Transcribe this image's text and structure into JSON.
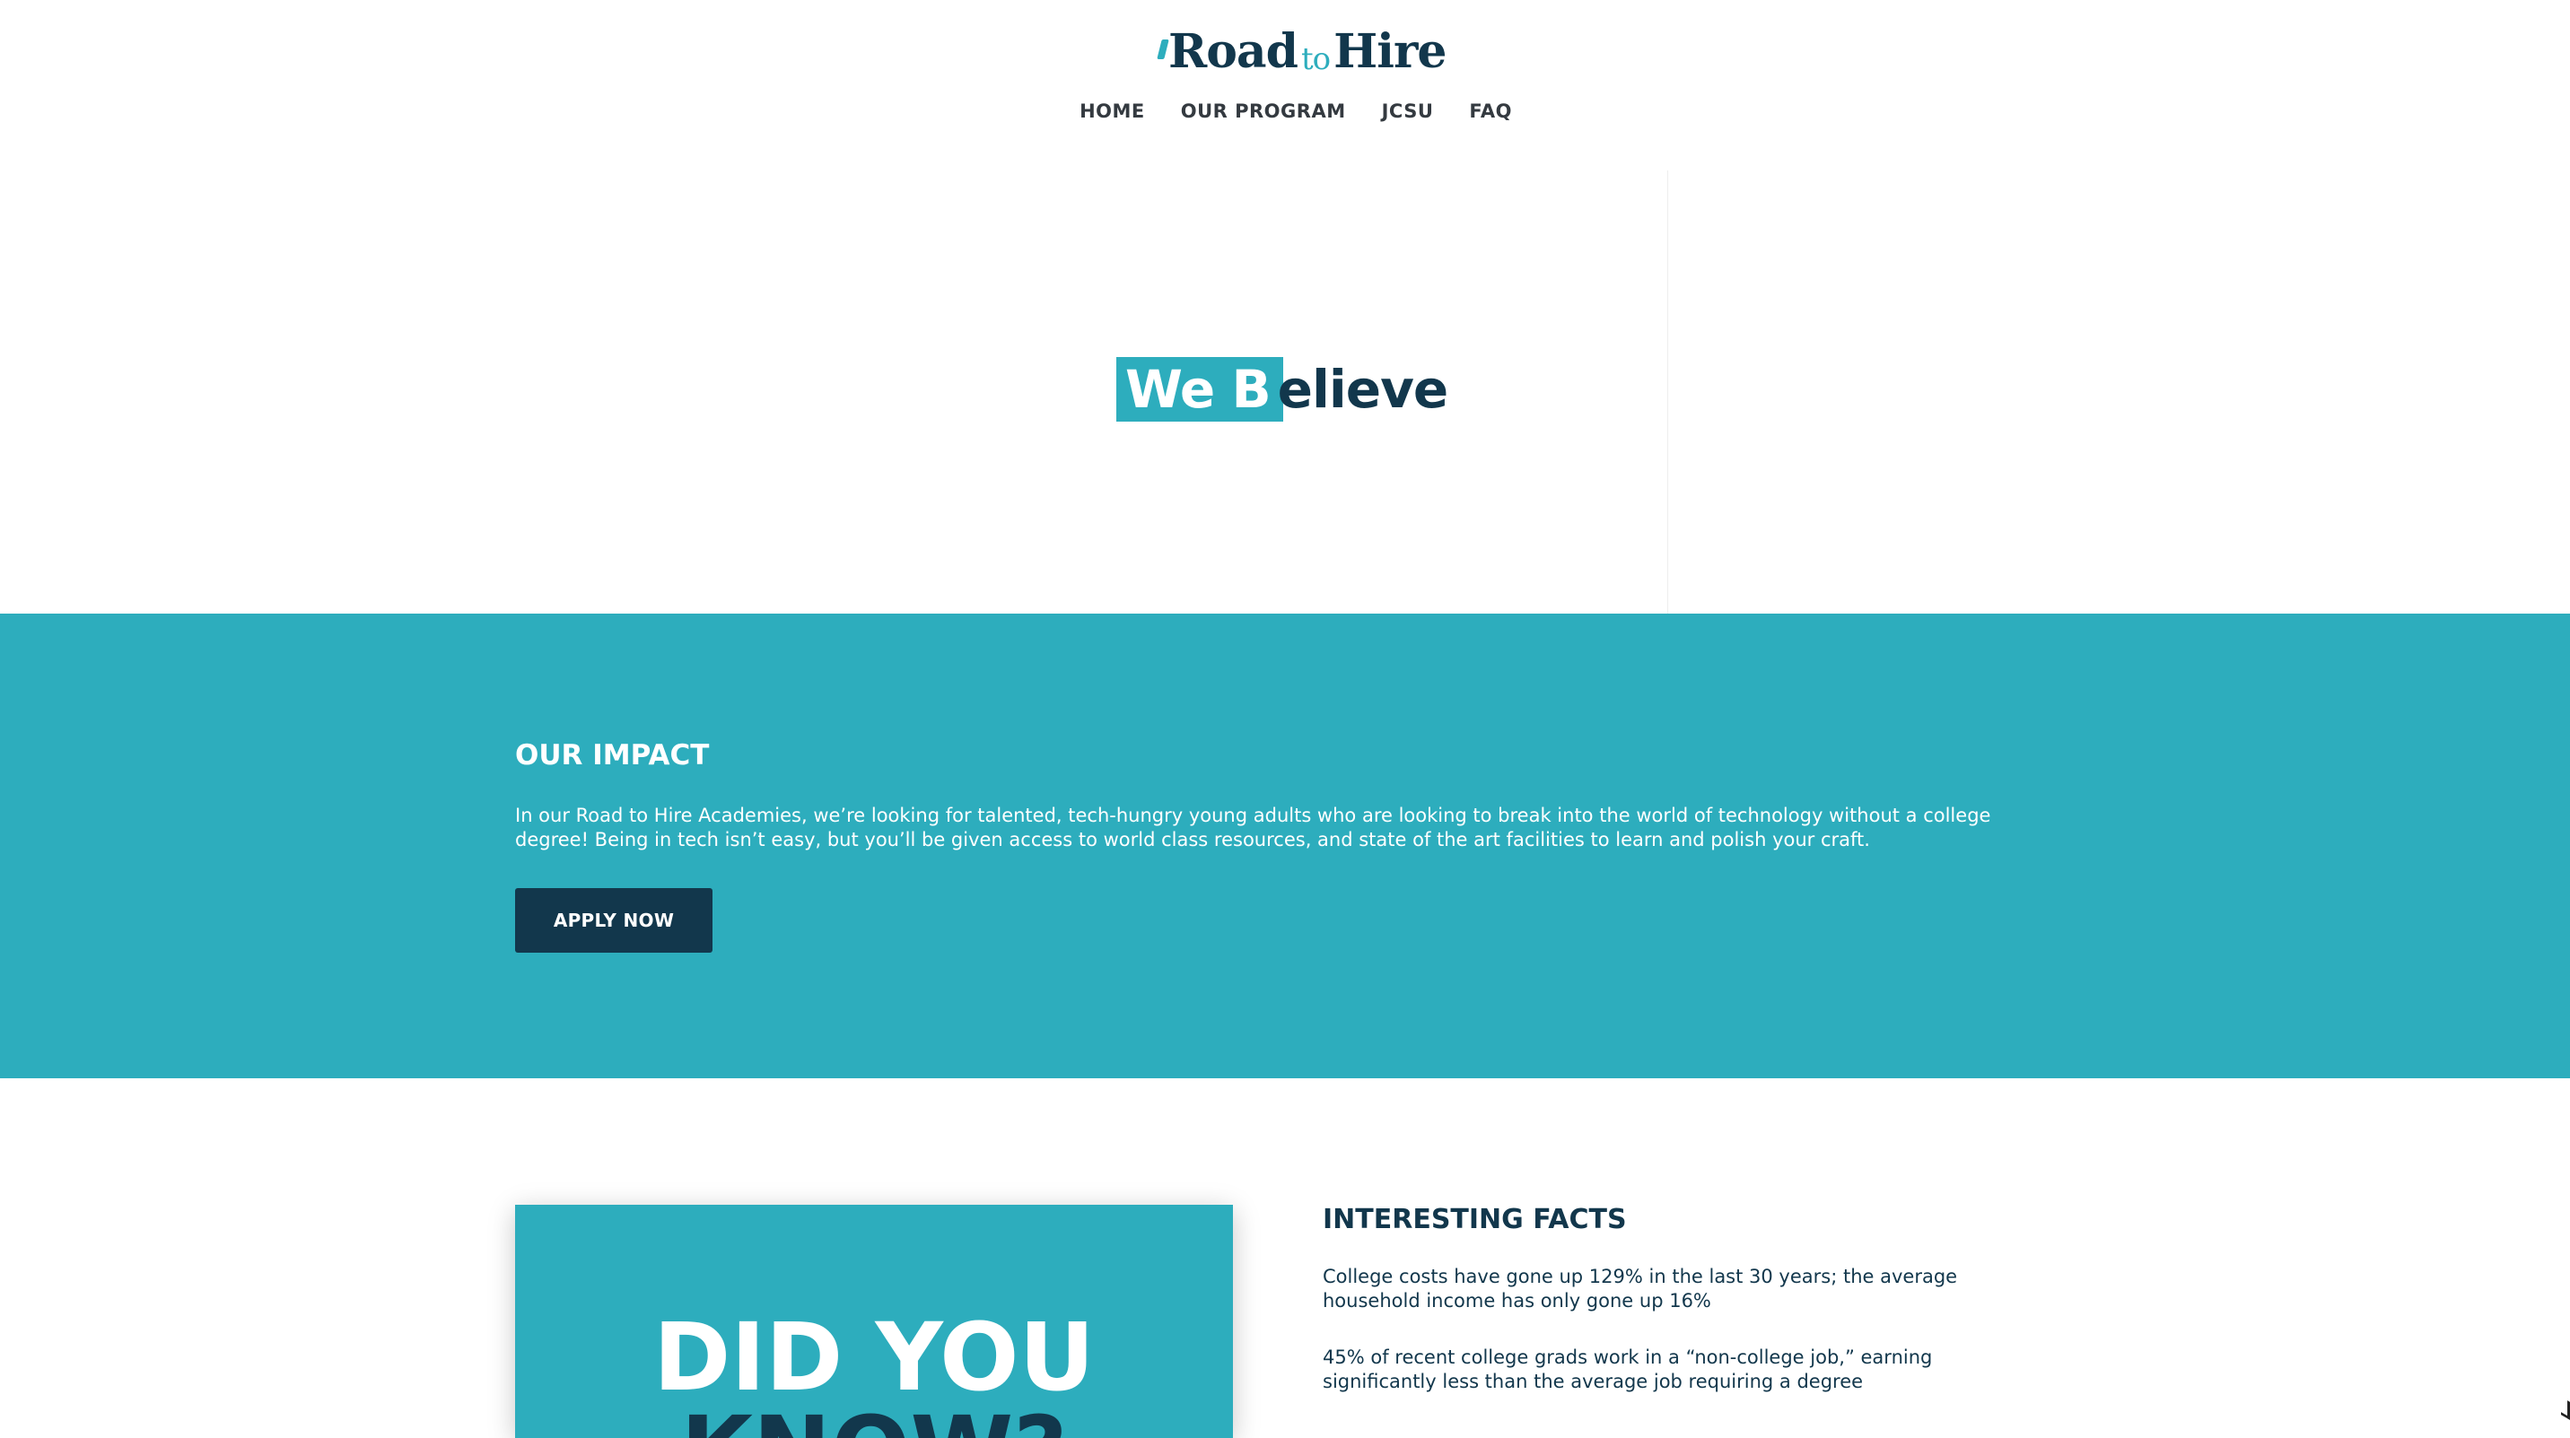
{
  "header": {
    "logo": {
      "word1": "Road",
      "word2": "to",
      "word3": "Hire"
    },
    "nav": [
      {
        "label": "HOME"
      },
      {
        "label": "OUR PROGRAM"
      },
      {
        "label": "JCSU"
      },
      {
        "label": "FAQ"
      }
    ]
  },
  "hero": {
    "highlight": "We B",
    "rest": "elieve"
  },
  "impact": {
    "title": "OUR IMPACT",
    "body": "In our Road to Hire Academies, we’re looking for talented, tech-hungry young adults who are looking to break into the world of technology without a college degree! Being in tech isn’t easy, but you’ll be given access to world class resources, and state of the art facilities to learn and polish your craft.",
    "button_label": "APPLY NOW"
  },
  "facts": {
    "card_line1": "DID YOU",
    "card_line2": "KNOW?",
    "title": "INTERESTING FACTS",
    "items": [
      "College costs have gone up 129% in the last 30 years; the average household income has only gone up 16%",
      "45% of recent college grads work in a “non-college job,” earning significantly less than the average job requiring a degree"
    ]
  },
  "colors": {
    "brand_teal": "#2dadbd",
    "brand_navy": "#12374c",
    "nav_text": "#343a40",
    "background": "#ffffff"
  },
  "icons": [
    "logo-road-mark-icon"
  ]
}
